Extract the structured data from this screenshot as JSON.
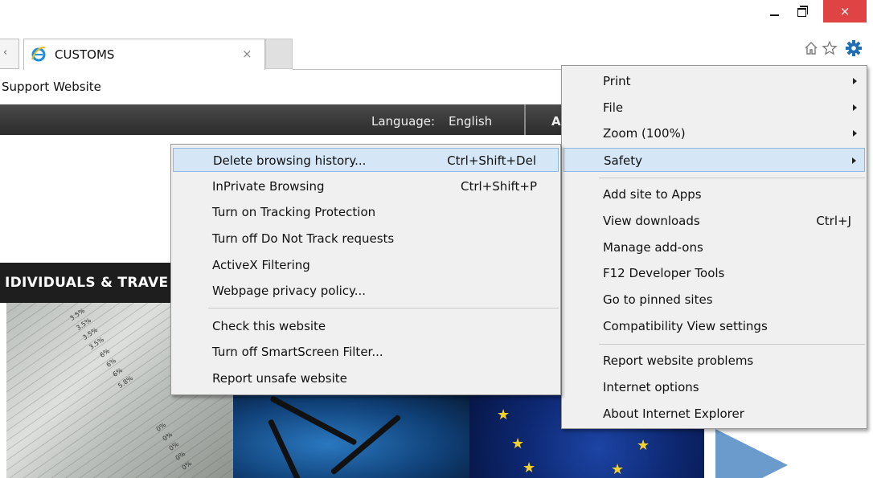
{
  "window_controls": {
    "minimize": "minimize",
    "maximize": "maximize",
    "close": "×"
  },
  "tab": {
    "title": "CUSTOMS",
    "close": "×",
    "left_chevron": "‹"
  },
  "favorites_bar": {
    "link": "Support Website"
  },
  "toolbar_icons": [
    "home-icon",
    "favorites-star-icon",
    "tools-gear-icon"
  ],
  "site": {
    "language_label": "Language:",
    "language_value": "English",
    "header_letter": "A",
    "band_title": "IDIVIDUALS & TRAVE",
    "ledger_percentages": [
      "3.5%",
      "3.5%",
      "3.5%",
      "3.5%",
      "6%",
      "6%",
      "6%",
      "5.8%",
      "0%",
      "0%",
      "0%",
      "0%",
      "0%"
    ]
  },
  "tools_menu": {
    "items": [
      {
        "label": "Print",
        "submenu": true
      },
      {
        "label": "File",
        "submenu": true
      },
      {
        "label": "Zoom (100%)",
        "submenu": true
      },
      {
        "label": "Safety",
        "submenu": true,
        "highlighted": true
      },
      {
        "label": "Add site to Apps"
      },
      {
        "label": "View downloads",
        "accelerator": "Ctrl+J"
      },
      {
        "label": "Manage add-ons"
      },
      {
        "label": "F12 Developer Tools"
      },
      {
        "label": "Go to pinned sites"
      },
      {
        "label": "Compatibility View settings"
      },
      {
        "label": "Report website problems"
      },
      {
        "label": "Internet options"
      },
      {
        "label": "About Internet Explorer"
      }
    ]
  },
  "safety_menu": {
    "items": [
      {
        "label": "Delete browsing history...",
        "accelerator": "Ctrl+Shift+Del",
        "highlighted": true
      },
      {
        "label": "InPrivate Browsing",
        "accelerator": "Ctrl+Shift+P"
      },
      {
        "label": "Turn on Tracking Protection"
      },
      {
        "label": "Turn off Do Not Track requests"
      },
      {
        "label": "ActiveX Filtering"
      },
      {
        "label": "Webpage privacy policy..."
      },
      {
        "label": "Check this website"
      },
      {
        "label": "Turn off SmartScreen Filter..."
      },
      {
        "label": "Report unsafe website"
      }
    ]
  },
  "colors": {
    "menu_background": "#f0f0f0",
    "menu_highlight": "#d5e6f7",
    "menu_highlight_border": "#8fb7e3",
    "close_button": "#e04343",
    "gear_icon": "#1f6fb4"
  }
}
